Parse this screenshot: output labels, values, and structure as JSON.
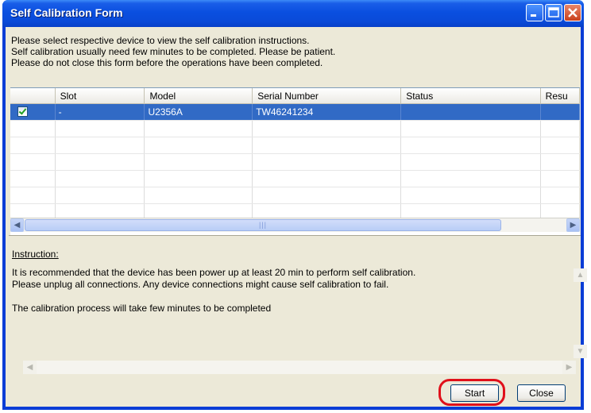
{
  "window": {
    "title": "Self Calibration Form",
    "accent": "#0a3dd6"
  },
  "intro": {
    "lines": [
      "Please select respective device to view the self calibration instructions.",
      "Self calibration usually need few minutes to be completed. Please be patient.",
      "Please do not close this form before the operations have been completed."
    ]
  },
  "table": {
    "columns": [
      "",
      "Slot",
      "Model",
      "Serial Number",
      "Status",
      "Resu"
    ],
    "rows": [
      {
        "checked": true,
        "slot": "-",
        "model": "U2356A",
        "serial": "TW46241234",
        "status": "",
        "result": ""
      }
    ],
    "selected_color": "#316ac5"
  },
  "instruction": {
    "label": "Instruction:",
    "lines": [
      "It is recommended that the device has been power up at least 20 min to perform self calibration.",
      "Please unplug all connections. Any device connections might cause self calibration to fail.",
      "",
      "The calibration process will take few minutes to be completed"
    ]
  },
  "buttons": {
    "start": "Start",
    "close": "Close"
  },
  "icons": {
    "minimize": "minimize-icon",
    "maximize": "maximize-icon",
    "close": "close-icon",
    "scroll_left": "arrow-left-icon",
    "scroll_right": "arrow-right-icon",
    "scroll_up": "arrow-up-icon",
    "scroll_down": "arrow-down-icon",
    "checkbox": "check-icon"
  }
}
